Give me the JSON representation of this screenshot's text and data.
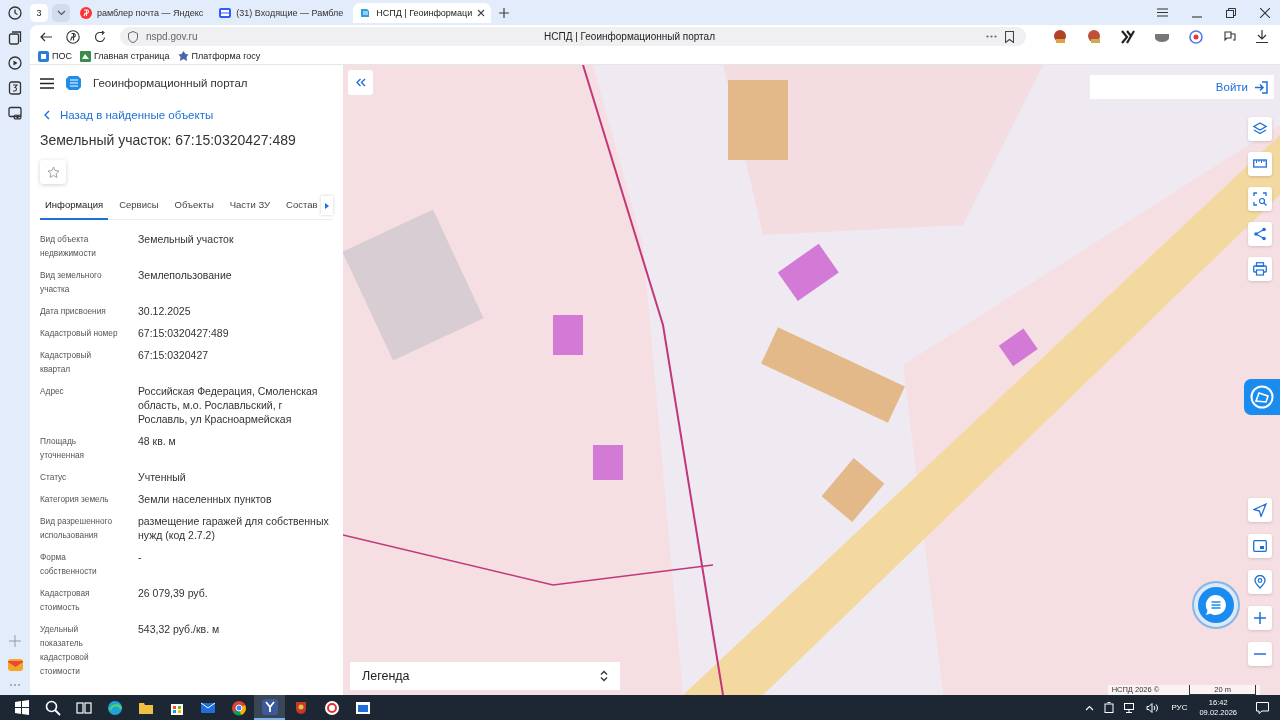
{
  "browser": {
    "tab_count": "3",
    "tabs": [
      {
        "title": "рамблер почта — Яндекс",
        "selected": false
      },
      {
        "title": "(31) Входящие — Рамбле",
        "selected": false
      },
      {
        "title": "НСПД | Геоинформаци",
        "selected": true
      }
    ],
    "address": "nspd.gov.ru",
    "page_title": "НСПД | Геоинформационный портал",
    "bookmarks": [
      "ПОС",
      "Главная страница",
      "Платформа госу"
    ]
  },
  "panel": {
    "app_title": "Геоинформационный портал",
    "back_link": "Назад в найденные объекты",
    "heading": "Земельный участок: 67:15:0320427:489",
    "tabs": [
      {
        "label": "Информация",
        "selected": true
      },
      {
        "label": "Сервисы",
        "selected": false
      },
      {
        "label": "Объекты",
        "selected": false
      },
      {
        "label": "Части ЗУ",
        "selected": false
      },
      {
        "label": "Состав",
        "selected": false
      }
    ],
    "fields": [
      {
        "label": "Вид объекта недвижимости",
        "value": "Земельный участок"
      },
      {
        "label": "Вид земельного участка",
        "value": "Землепользование"
      },
      {
        "label": "Дата присвоения",
        "value": "30.12.2025"
      },
      {
        "label": "Кадастровый номер",
        "value": "67:15:0320427:489"
      },
      {
        "label": "Кадастровый квартал",
        "value": "67:15:0320427"
      },
      {
        "label": "Адрес",
        "value": "Российская Федерация, Смоленская область, м.о. Рославльский, г Рославль, ул Красноармейская"
      },
      {
        "label": "Площадь уточненная",
        "value": "48 кв. м"
      },
      {
        "label": "Статус",
        "value": "Учтенный"
      },
      {
        "label": "Категория земель",
        "value": "Земли населенных пунктов"
      },
      {
        "label": "Вид разрешенного использования",
        "value": "размещение гаражей для собственных нужд (код 2.7.2)"
      },
      {
        "label": "Форма собственности",
        "value": "-"
      },
      {
        "label": "Кадастровая стоимость",
        "value": "26 079,39 руб."
      },
      {
        "label": "Удельный показатель кадастровой стоимости",
        "value": "543,32 руб./кв. м"
      }
    ]
  },
  "map": {
    "login": "Войти",
    "legend": "Легенда",
    "attribution": "НСПД 2026 ©",
    "scale": "20 m"
  },
  "taskbar": {
    "language": "РУС",
    "time": "16:42",
    "date": "09.02.2026"
  }
}
